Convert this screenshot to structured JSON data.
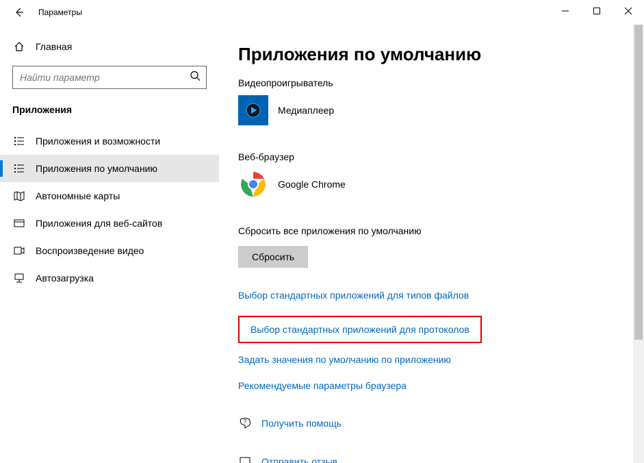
{
  "titlebar": {
    "title": "Параметры"
  },
  "sidebar": {
    "home": "Главная",
    "search_placeholder": "Найти параметр",
    "section": "Приложения",
    "items": [
      {
        "label": "Приложения и возможности"
      },
      {
        "label": "Приложения по умолчанию"
      },
      {
        "label": "Автономные карты"
      },
      {
        "label": "Приложения для веб-сайтов"
      },
      {
        "label": "Воспроизведение видео"
      },
      {
        "label": "Автозагрузка"
      }
    ]
  },
  "content": {
    "title": "Приложения по умолчанию",
    "video_header": "Видеопроигрыватель",
    "video_app": "Медиаплеер",
    "web_header": "Веб-браузер",
    "web_app": "Google Chrome",
    "reset_header": "Сбросить все приложения по умолчанию",
    "reset_button": "Сбросить",
    "links": [
      "Выбор стандартных приложений для типов файлов",
      "Выбор стандартных приложений для протоколов",
      "Задать значения по умолчанию по приложению",
      "Рекомендуемые параметры браузера"
    ],
    "help": "Получить помощь",
    "feedback": "Отправить отзыв"
  }
}
